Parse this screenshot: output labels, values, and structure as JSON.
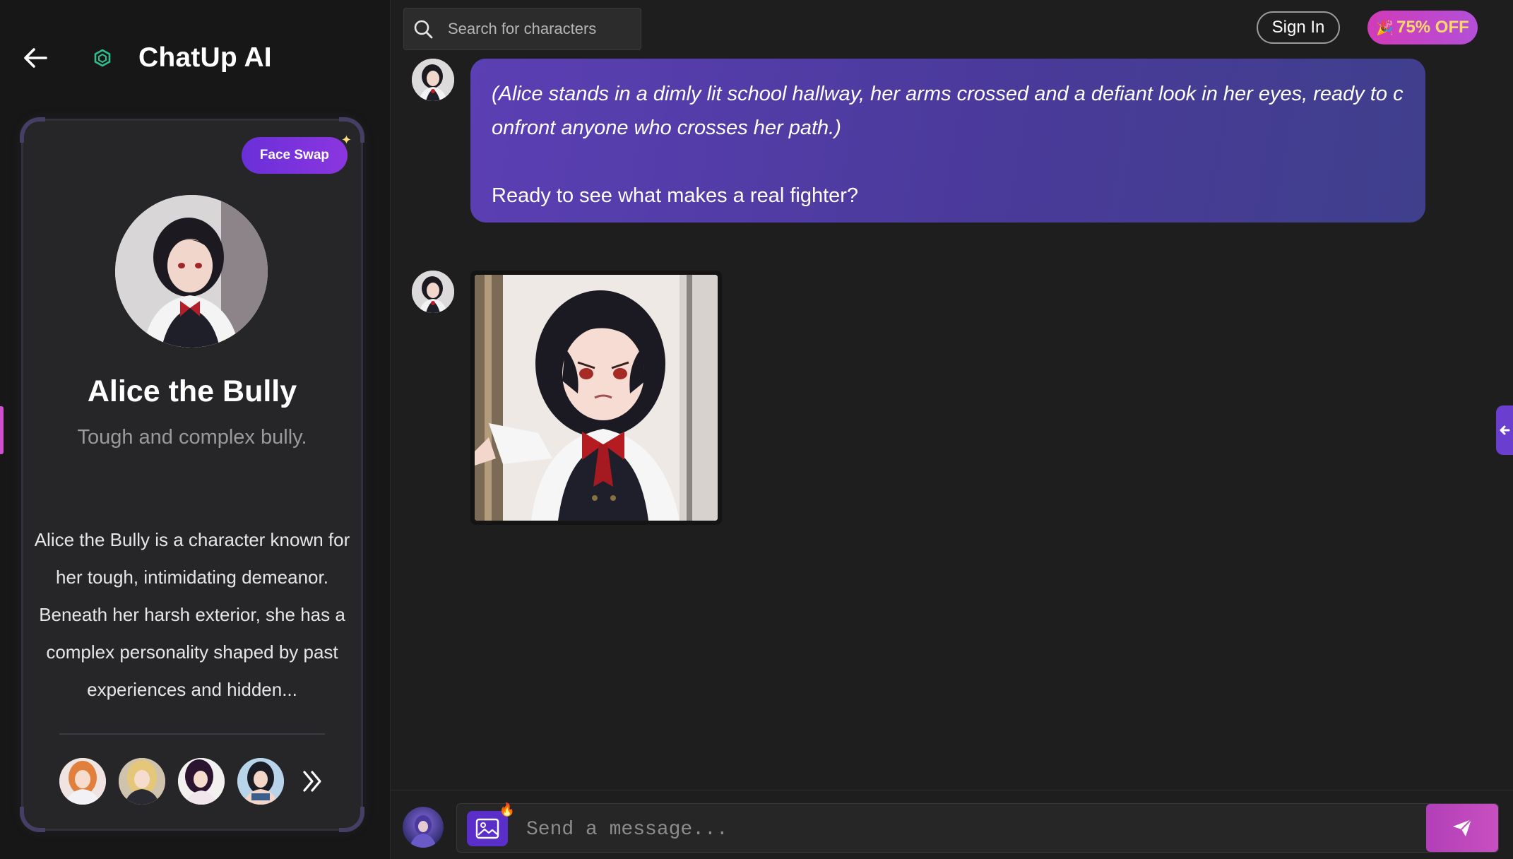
{
  "app": {
    "title": "ChatUp AI"
  },
  "search": {
    "placeholder": "Search for characters"
  },
  "header": {
    "sign_in_label": "Sign In",
    "promo_label": "75% OFF"
  },
  "character": {
    "face_swap_label": "Face Swap",
    "name": "Alice the Bully",
    "tagline": "Tough and complex bully.",
    "description": "Alice the Bully is a character known for her tough, intimidating demeanor. Beneath her harsh exterior, she has a complex personality shaped by past experiences and hidden..."
  },
  "related_characters": [
    {
      "icon": "avatar-orange-hair"
    },
    {
      "icon": "avatar-blonde-hair"
    },
    {
      "icon": "avatar-dark-hair"
    },
    {
      "icon": "avatar-black-hair"
    }
  ],
  "chat": {
    "messages": [
      {
        "narration": "(Alice stands in a dimly lit school hallway, her arms crossed and a defiant look in her eyes, ready to confront anyone who crosses her path.)",
        "text": "Ready to see what makes a real fighter?"
      }
    ]
  },
  "composer": {
    "placeholder": "Send a message..."
  },
  "colors": {
    "bubble": "#5b3fb4",
    "accent_purple": "#6a2fd8",
    "send_pink": "#c84fc0",
    "promo_text": "#ffd86a"
  },
  "icons": {
    "back": "arrow-left-icon",
    "logo": "hexagon-logo-icon",
    "search": "search-icon",
    "more": "double-chevron-right-icon",
    "image_gen": "image-icon",
    "send": "send-icon",
    "collapse": "arrow-left-icon"
  }
}
